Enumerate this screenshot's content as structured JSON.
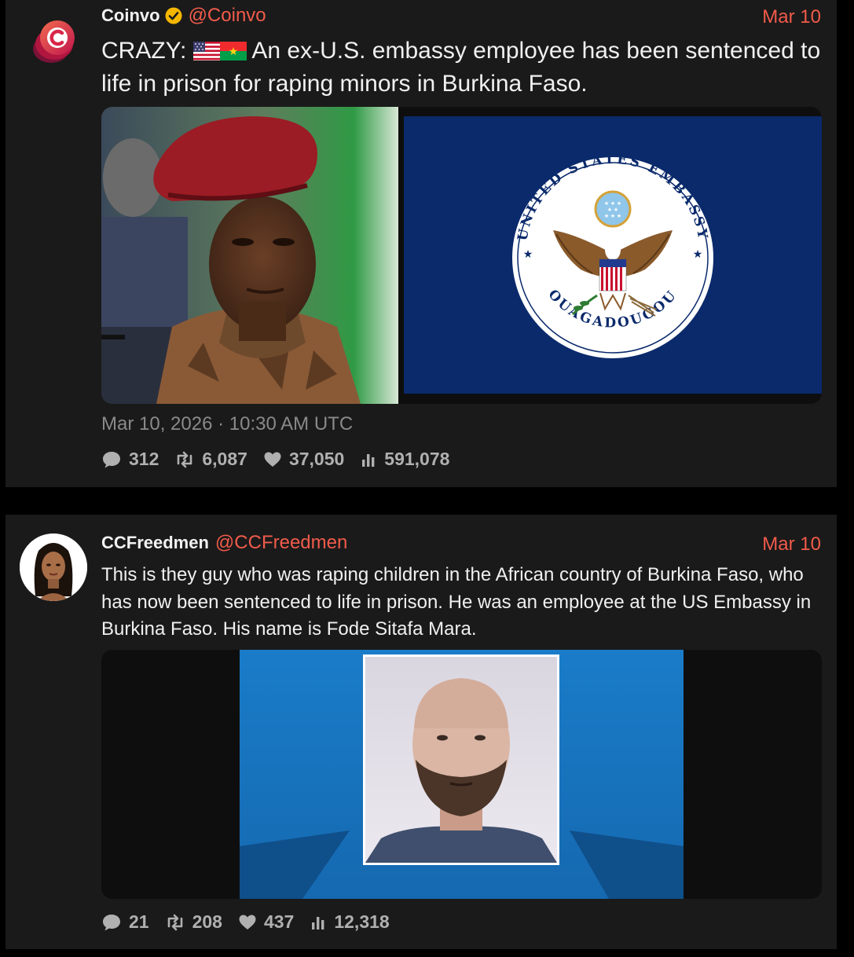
{
  "tweets": [
    {
      "author_name": "Coinvo",
      "handle": "@Coinvo",
      "date": "Mar 10",
      "text_prefix": "CRAZY:",
      "text_main": "An ex-U.S. embassy employee has been sentenced to life in prison for raping minors in Burkina Faso.",
      "timestamp": "Mar 10, 2026 · 10:30 AM UTC",
      "stats": {
        "replies": "312",
        "retweets": "6,087",
        "likes": "37,050",
        "views": "591,078"
      },
      "seal": {
        "top_text": "UNITED STATES EMBASSY",
        "bottom_text": "OUAGADOUGOU"
      }
    },
    {
      "author_name": "CCFreedmen",
      "handle": "@CCFreedmen",
      "date": "Mar 10",
      "text": "This is they guy who was raping children in the African country of Burkina Faso, who has now been sentenced to life in prison. He was an employee at the US Embassy in Burkina Faso. His name is Fode Sitafa Mara.",
      "stats": {
        "replies": "21",
        "retweets": "208",
        "likes": "437",
        "views": "12,318"
      }
    }
  ],
  "colors": {
    "accent": "#f15b4b",
    "card_bg": "#1a1a1a",
    "page_bg": "#000000",
    "verified": "#f5b600",
    "muted": "#8a8a8a"
  },
  "icons": [
    "coinvo-logo-icon",
    "verified-badge-icon",
    "us-flag-icon",
    "burkina-faso-flag-icon",
    "reply-icon",
    "retweet-icon",
    "like-icon",
    "views-icon"
  ]
}
